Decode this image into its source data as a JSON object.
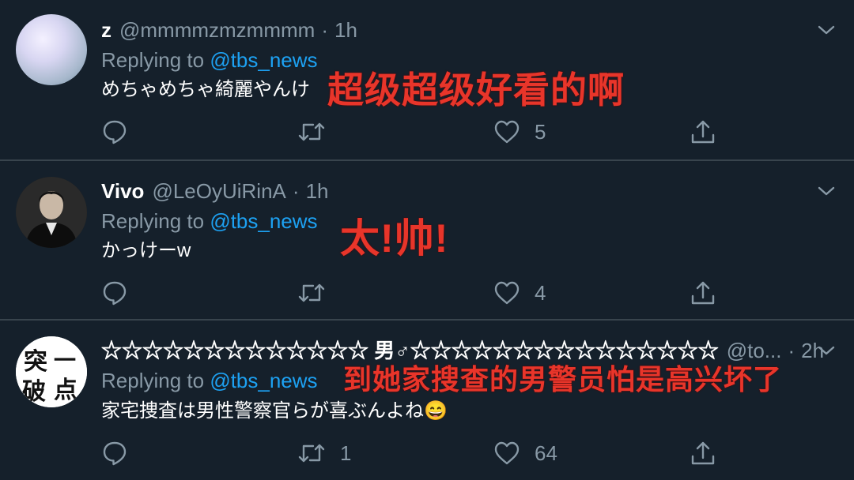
{
  "tweets": [
    {
      "name": "z",
      "handle": "@mmmmzmzmmmm",
      "separator": "·",
      "time": "1h",
      "replying_prefix": "Replying to ",
      "replying_to": "@tbs_news",
      "text": "めちゃめちゃ綺麗やんけ",
      "overlay_caption": "超级超级好看的啊",
      "replies": "",
      "retweets": "",
      "likes": "5",
      "avatar": "pale-gradient-orb"
    },
    {
      "name": "Vivo",
      "handle": "@LeOyUiRinA",
      "separator": "·",
      "time": "1h",
      "replying_prefix": "Replying to ",
      "replying_to": "@tbs_news",
      "text": "かっけーw",
      "overlay_caption": "太!帅!",
      "replies": "",
      "retweets": "",
      "likes": "4",
      "avatar": "person-photo"
    },
    {
      "name": "☆☆☆☆☆☆☆☆☆☆☆☆☆ 男♂☆☆☆☆☆☆☆☆☆☆☆☆☆☆☆",
      "handle": "@to...",
      "separator": "·",
      "time": "2h",
      "replying_prefix": "Replying to ",
      "replying_to": "@tbs_news",
      "text": "家宅捜査は男性警察官らが喜ぶんよね😄",
      "overlay_caption": "到她家搜查的男警员怕是高兴坏了",
      "replies": "",
      "retweets": "1",
      "likes": "64",
      "avatar": "calligraphy-logo",
      "avatar_text": "一点 突破"
    }
  ],
  "icons": {
    "reply": "reply-icon",
    "retweet": "retweet-icon",
    "like": "heart-icon",
    "share": "share-icon",
    "more": "chevron-down-icon"
  },
  "colors": {
    "background": "#15202b",
    "divider": "#38444d",
    "secondary_text": "#8899a6",
    "mention": "#1da1f2",
    "overlay_red": "#e8352a"
  }
}
